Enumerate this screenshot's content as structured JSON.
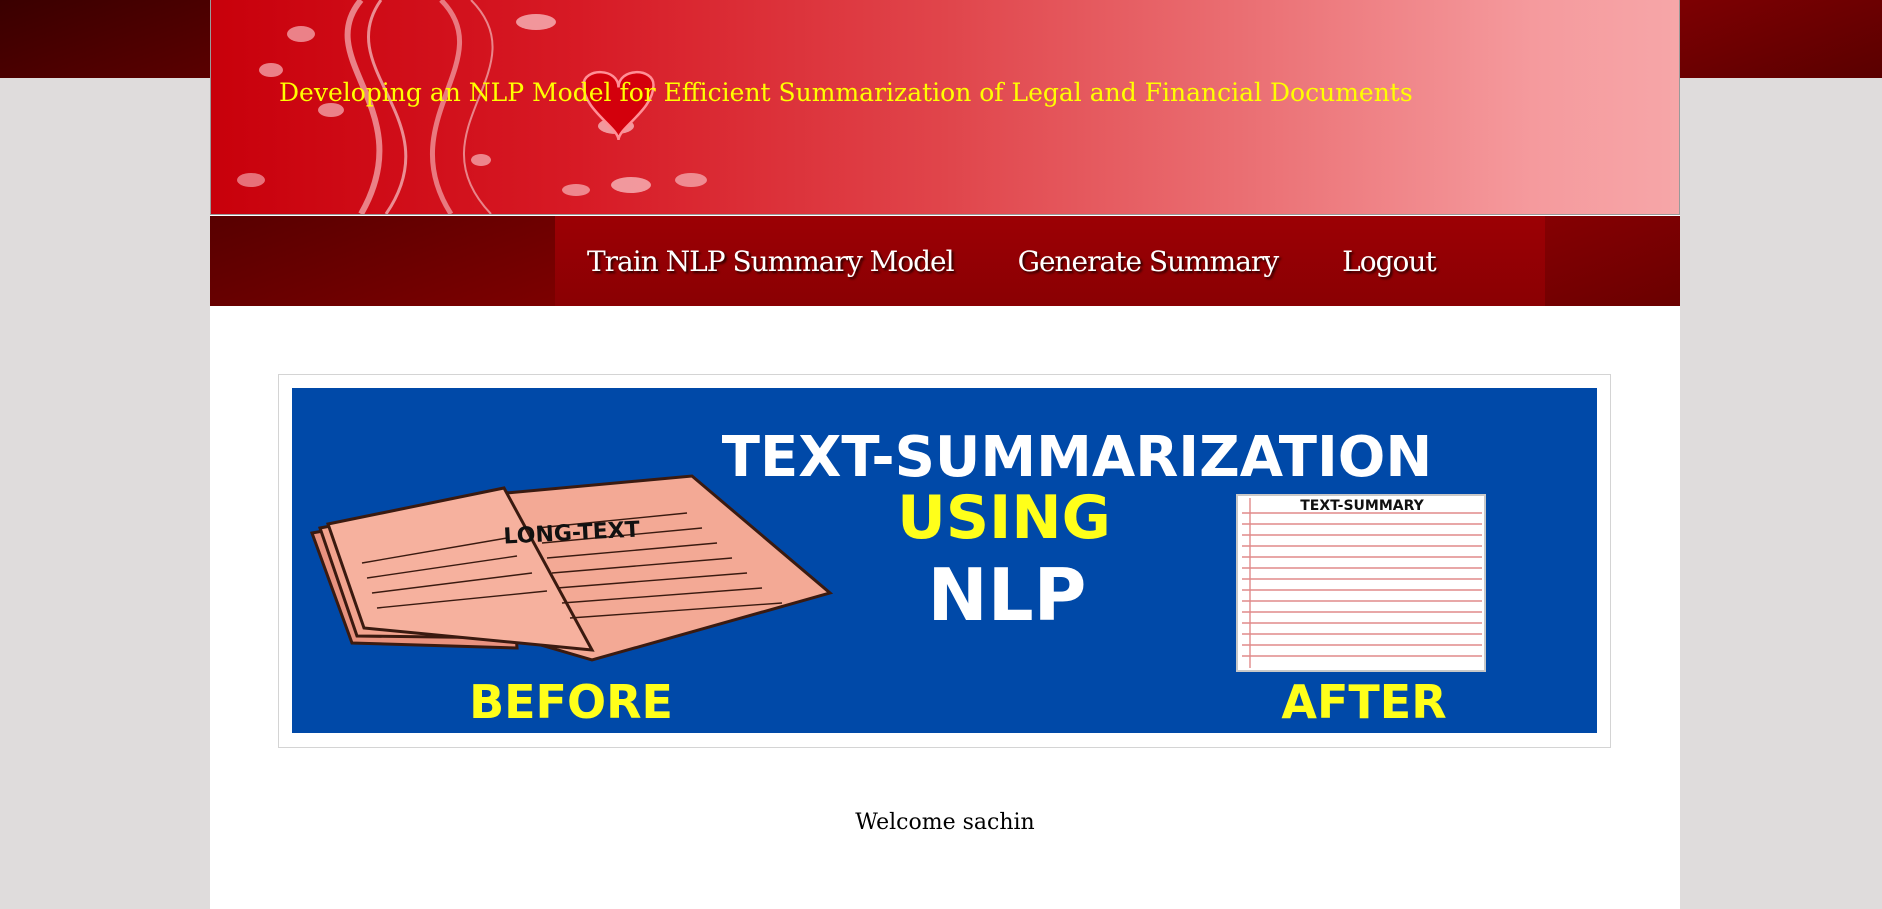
{
  "header": {
    "title": "Developing an NLP Model for Efficient Summarization of Legal and Financial Documents"
  },
  "nav": {
    "items": [
      {
        "label": "Train NLP Summary Model"
      },
      {
        "label": "Generate Summary"
      },
      {
        "label": "Logout"
      }
    ]
  },
  "banner": {
    "title": "TEXT-SUMMARIZATION",
    "using": "USING",
    "nlp": "NLP",
    "before": "BEFORE",
    "after": "AFTER",
    "long_text": "LONG-TEXT",
    "text_summary": "TEXT-SUMMARY"
  },
  "welcome": "Welcome sachin",
  "colors": {
    "title_yellow": "#ffff00",
    "nav_red": "#9c0004",
    "banner_blue": "#0049a8",
    "banner_yellow": "#ffff1a"
  }
}
